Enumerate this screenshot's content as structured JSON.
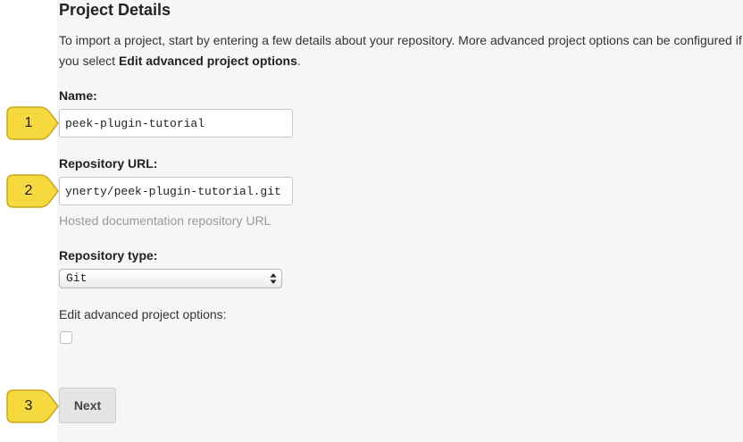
{
  "page": {
    "title": "Project Details",
    "intro_text": "To import a project, start by entering a few details about your repository. More advanced project options can be configured if you select ",
    "intro_emphasis": "Edit advanced project options",
    "intro_end": "."
  },
  "form": {
    "name_label": "Name:",
    "name_value": "peek-plugin-tutorial",
    "repo_url_label": "Repository URL:",
    "repo_url_value": "ynerty/peek-plugin-tutorial.git",
    "repo_url_help": "Hosted documentation repository URL",
    "repo_type_label": "Repository type:",
    "repo_type_selected": "Git",
    "advanced_label": "Edit advanced project options:",
    "advanced_checked": false,
    "next_label": "Next"
  },
  "callouts": [
    {
      "number": "1"
    },
    {
      "number": "2"
    },
    {
      "number": "3"
    }
  ],
  "colors": {
    "callout_fill": "#f6d93e",
    "panel_background": "#f6f6f6",
    "help_text": "#9a9a9a"
  }
}
